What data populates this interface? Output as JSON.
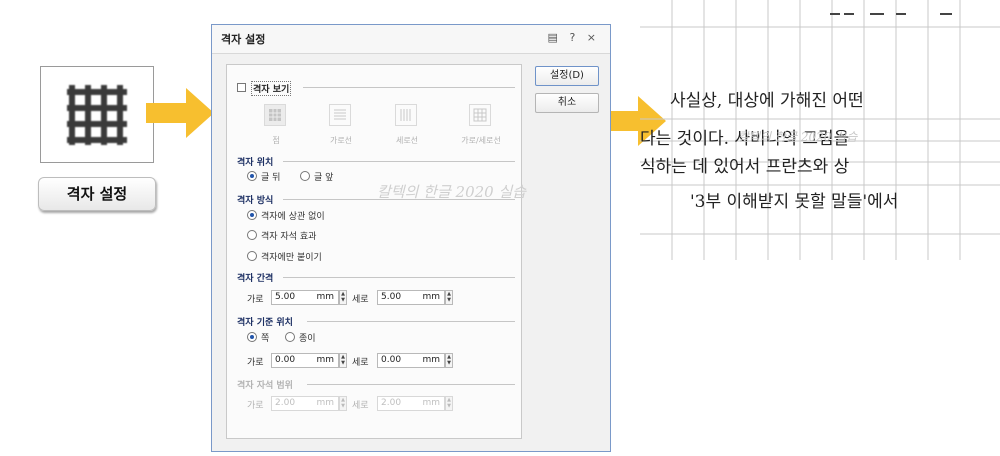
{
  "caption": {
    "label": "격자 설정"
  },
  "dialog": {
    "title": "격자 설정",
    "titlebar_icons": {
      "menu": "menu-icon",
      "help": "?",
      "close": "×"
    },
    "buttons": {
      "ok": "설정(D)",
      "cancel": "취소"
    },
    "show_grid": {
      "label": "격자 보기",
      "checked": false
    },
    "grid_types": [
      "점",
      "가로선",
      "세로선",
      "가로/세로선"
    ],
    "position": {
      "title": "격자 위치",
      "options": [
        "글 뒤",
        "글 앞"
      ],
      "selected": "글 뒤"
    },
    "mode": {
      "title": "격자 방식",
      "options": [
        "격자에 상관 없이",
        "격자 자석 효과",
        "격자에만 붙이기"
      ],
      "selected": "격자에 상관 없이"
    },
    "spacing": {
      "title": "격자 간격",
      "h_label": "가로",
      "h_value": "5.00",
      "v_label": "세로",
      "v_value": "5.00",
      "unit": "mm"
    },
    "origin": {
      "title": "격자 기준 위치",
      "options": [
        "쪽",
        "종이"
      ],
      "selected": "쪽",
      "h_label": "가로",
      "h_value": "0.00",
      "v_label": "세로",
      "v_value": "0.00",
      "unit": "mm"
    },
    "magnet": {
      "title": "격자 자석 범위",
      "h_label": "가로",
      "h_value": "2.00",
      "v_label": "세로",
      "v_value": "2.00",
      "unit": "mm"
    },
    "watermark": "칼텍의 한글 2020 실습"
  },
  "document": {
    "lines": [
      "사실상, 대상에 가해진 어떤",
      "다는 것이다. 사비나의 그림을",
      "식하는 데 있어서 프란츠와 상",
      "'3부 이해받지 못할 말들'에서"
    ],
    "watermark": "칼텍의 한글 2020 실습"
  },
  "colors": {
    "arrow": "#f7bf2f",
    "dialog_border": "#7a99c9",
    "section_title": "#1c2f63"
  }
}
